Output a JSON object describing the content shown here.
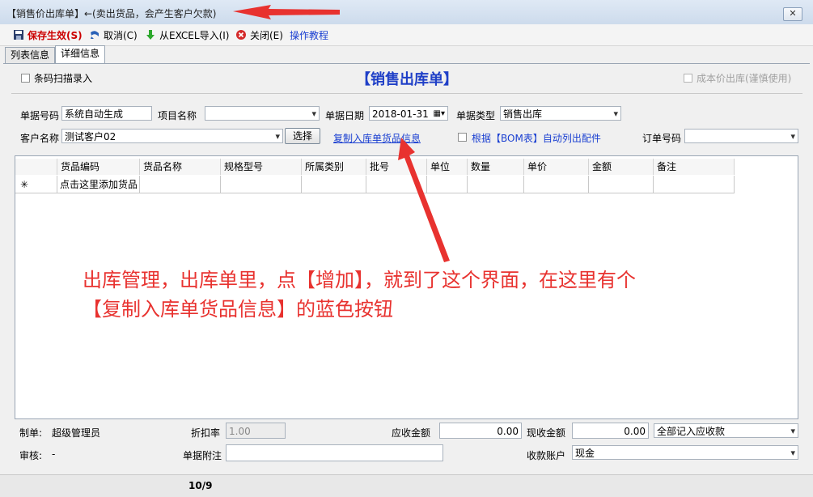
{
  "window": {
    "title": "【销售价出库单】←(卖出货品，会产生客户欠款)",
    "close": "✕"
  },
  "toolbar": {
    "save": "保存生效(S)",
    "cancel": "取消(C)",
    "import": "从EXCEL导入(I)",
    "close": "关闭(E)",
    "tutorial": "操作教程"
  },
  "tabs": [
    {
      "label": "列表信息"
    },
    {
      "label": "详细信息"
    }
  ],
  "header": {
    "barcode_label": "条码扫描录入",
    "form_title": "【销售出库单】",
    "cost_price_label": "成本价出库(谨慎使用)"
  },
  "form": {
    "doc_no_label": "单据号码",
    "doc_no_value": "系统自动生成",
    "project_label": "项目名称",
    "project_value": "",
    "date_label": "单据日期",
    "date_value": "2018-01-31",
    "type_label": "单据类型",
    "type_value": "销售出库",
    "customer_label": "客户名称",
    "customer_value": "测试客户02",
    "select_button": "选择",
    "copy_link": "复制入库单货品信息",
    "bom_label": "根据【BOM表】自动列出配件",
    "order_label": "订单号码",
    "order_value": ""
  },
  "grid": {
    "columns": [
      "货品编码",
      "货品名称",
      "规格型号",
      "所属类别",
      "批号",
      "单位",
      "数量",
      "单价",
      "金额",
      "备注"
    ],
    "new_row_marker": "✳",
    "new_row_hint": "点击这里添加货品"
  },
  "footer": {
    "maker_label": "制单:",
    "maker_value": "超级管理员",
    "discount_label": "折扣率",
    "discount_value": "1.00",
    "receivable_label": "应收金额",
    "receivable_value": "0.00",
    "cash_label": "现收金额",
    "cash_value": "0.00",
    "record_option": "全部记入应收款",
    "auditor_label": "审核:",
    "auditor_value": "-",
    "note_label": "单据附注",
    "note_value": "",
    "account_label": "收款账户",
    "account_value": "现金"
  },
  "status": {
    "page": "10/9"
  },
  "annotation": {
    "line1": "出库管理，出库单里，点【增加】，就到了这个界面，在这里有个",
    "line2": "【复制入库单货品信息】的蓝色按钮"
  },
  "colors": {
    "annotation": "#e8322f",
    "link": "#1a3fd1",
    "title_blue": "#1f3fc7",
    "save_red": "#cc0000"
  }
}
